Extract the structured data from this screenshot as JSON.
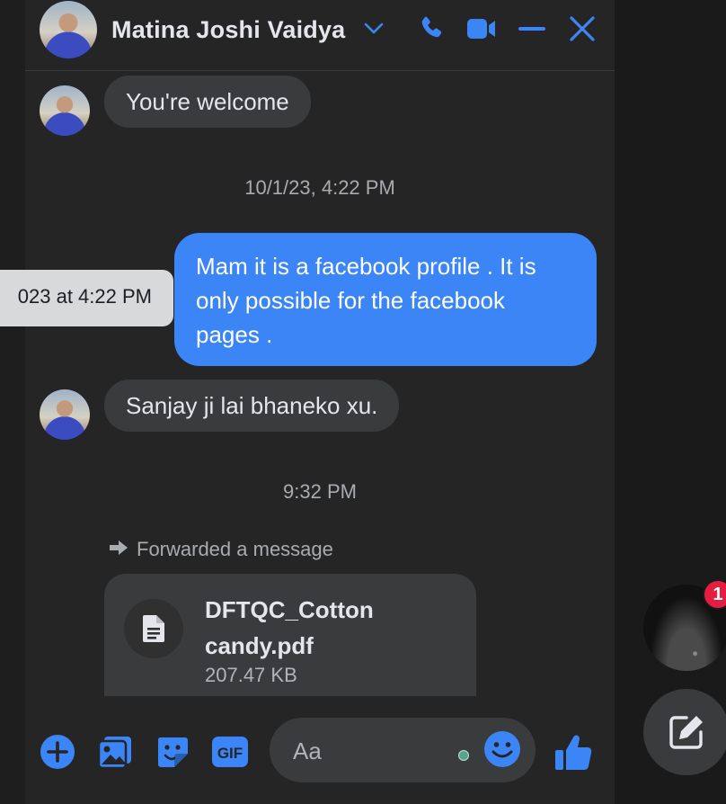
{
  "header": {
    "contact_name": "Matina Joshi Vaidya",
    "icons": [
      "chevron-down-icon",
      "phone-icon",
      "video-icon",
      "minimize-icon",
      "close-icon"
    ]
  },
  "colors": {
    "accent": "#3c85f7",
    "bubble_in": "#3a3b3c",
    "panel": "#252526",
    "badge": "#e41e3f"
  },
  "messages": {
    "m1": "You're welcome",
    "ts1": "10/1/23, 4:22 PM",
    "m2": "Mam it is a facebook profile . It is only possible for the facebook pages .",
    "tooltip": "023 at 4:22 PM",
    "m3": "Sanjay ji lai bhaneko xu.",
    "ts2": "9:32 PM",
    "forwarded_label": "Forwarded a message"
  },
  "attachment": {
    "file_name": "DFTQC_Cotton candy.pdf",
    "file_size": "207.47 KB"
  },
  "composer": {
    "placeholder": "Aa",
    "icons": [
      "plus-icon",
      "photo-icon",
      "sticker-icon",
      "gif-icon",
      "emoji-icon",
      "thumbs-up-icon"
    ]
  },
  "floating": {
    "badge_count": "1"
  }
}
